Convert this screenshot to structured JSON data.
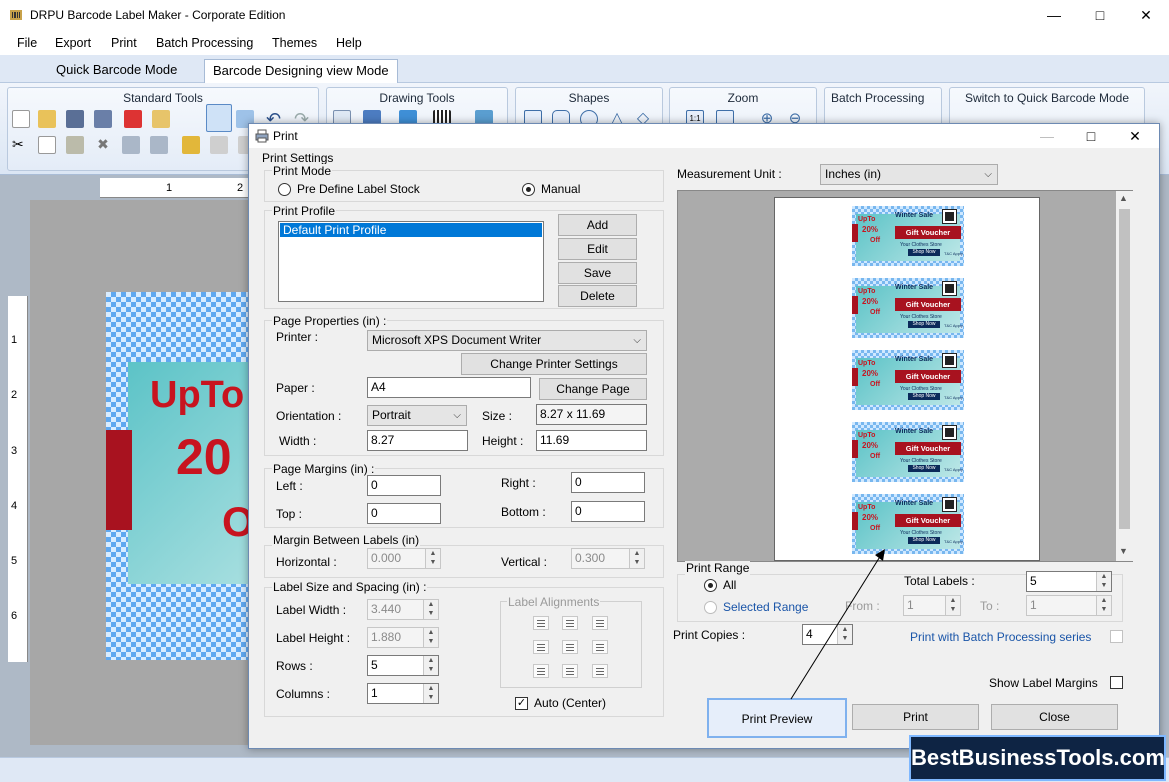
{
  "app": {
    "title": "DRPU Barcode Label Maker - Corporate Edition"
  },
  "menu": [
    "File",
    "Export",
    "Print",
    "Batch Processing",
    "Themes",
    "Help"
  ],
  "mode_tabs": [
    "Quick Barcode Mode",
    "Barcode Designing view Mode"
  ],
  "ribbon_groups": [
    "Standard Tools",
    "Drawing Tools",
    "Shapes",
    "Zoom",
    "Batch Processing",
    "Switch to Quick Barcode Mode"
  ],
  "ruler": {
    "top": [
      "1",
      "2"
    ],
    "left": [
      "1",
      "2",
      "3",
      "4",
      "5",
      "6"
    ]
  },
  "canvas_label": {
    "line1": "UpTo",
    "line2": "20",
    "line3": "O"
  },
  "dialog": {
    "title": "Print",
    "print_settings": "Print Settings",
    "print_mode": {
      "legend": "Print Mode",
      "option1": "Pre Define Label Stock",
      "option2": "Manual",
      "selected": "Manual"
    },
    "print_profile": {
      "legend": "Print Profile",
      "items": [
        "Default Print Profile"
      ],
      "add": "Add",
      "edit": "Edit",
      "save": "Save",
      "delete": "Delete"
    },
    "page_properties": {
      "legend": "Page Properties (in) :",
      "printer_label": "Printer :",
      "printer": "Microsoft XPS Document Writer",
      "change_printer": "Change Printer Settings",
      "paper_label": "Paper :",
      "paper": "A4",
      "change_page": "Change Page",
      "orientation_label": "Orientation :",
      "orientation": "Portrait",
      "size_label": "Size :",
      "size": "8.27 x 11.69",
      "width_label": "Width :",
      "width": "8.27",
      "height_label": "Height :",
      "height": "11.69"
    },
    "page_margins": {
      "legend": "Page Margins (in) :",
      "left_label": "Left :",
      "left": "0",
      "right_label": "Right :",
      "right": "0",
      "top_label": "Top :",
      "top": "0",
      "bottom_label": "Bottom :",
      "bottom": "0"
    },
    "margin_between": {
      "legend": "Margin Between Labels (in)",
      "h_label": "Horizontal :",
      "h": "0.000",
      "v_label": "Vertical :",
      "v": "0.300"
    },
    "label_size": {
      "legend": "Label Size and Spacing (in) :",
      "width_label": "Label Width :",
      "width": "3.440",
      "height_label": "Label Height :",
      "height": "1.880",
      "rows_label": "Rows :",
      "rows": "5",
      "cols_label": "Columns :",
      "cols": "1",
      "alignments": "Label Alignments",
      "auto_center": "Auto (Center)",
      "auto_center_checked": true
    },
    "measurement": {
      "label": "Measurement Unit :",
      "value": "Inches (in)"
    },
    "preview_label": {
      "upto": "UpTo",
      "pct": "20%",
      "off": "Off",
      "title": "Winter Sale",
      "voucher": "Gift Voucher",
      "store": "Your Clothes Store",
      "shop": "Shop Now",
      "tc": "T&C Apply",
      "count": 5
    },
    "print_range": {
      "legend": "Print Range",
      "all": "All",
      "selected_range": "Selected Range",
      "selected": "All",
      "from_label": "From :",
      "from": "1",
      "to_label": "To :",
      "to": "1",
      "total_label": "Total Labels :",
      "total": "5"
    },
    "copies": {
      "label": "Print Copies :",
      "value": "4"
    },
    "batch": "Print with Batch Processing series",
    "show_margins": "Show Label Margins",
    "buttons": {
      "preview": "Print Preview",
      "print": "Print",
      "close": "Close"
    }
  },
  "watermark": "BestBusinessTools.com",
  "colors": {
    "accent_red": "#a8121f",
    "title_blue": "#0b2a5a",
    "selection_blue": "#0078d7",
    "link_blue": "#1a55a8"
  }
}
